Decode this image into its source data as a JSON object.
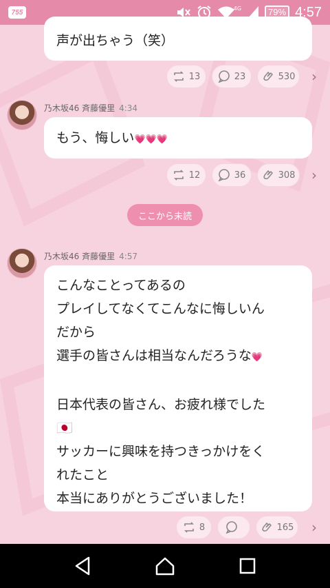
{
  "status_bar": {
    "app_badge": "755",
    "network": "4G",
    "battery": "79%",
    "time": "4:57"
  },
  "messages": [
    {
      "lines": [
        "声が出ちゃう（笑）"
      ],
      "actions": {
        "repost": "13",
        "comment": "23",
        "clap": "530"
      }
    },
    {
      "sender": "乃木坂46 斉藤優里",
      "time": "4:34",
      "lines": [
        "もう、悔しい"
      ],
      "actions": {
        "repost": "12",
        "comment": "36",
        "clap": "308"
      }
    },
    {
      "sender": "乃木坂46 斉藤優里",
      "time": "4:57",
      "lines": [
        "こんなことってあるの",
        "プレイしてなくてこんなに悔しいん",
        "だから",
        "選手の皆さんは相当なんだろうな",
        "",
        "日本代表の皆さん、お疲れ様でした",
        "🇯🇵",
        "サッカーに興味を持つきっかけをく",
        "れたこと",
        "本当にありがとうございました！"
      ],
      "actions": {
        "repost": "8",
        "comment": "",
        "clap": "165"
      }
    }
  ],
  "unread_label": "ここから未読",
  "colors": {
    "accent": "#e58aa8",
    "background": "#f7d3df",
    "pill": "#ee8fb0"
  }
}
